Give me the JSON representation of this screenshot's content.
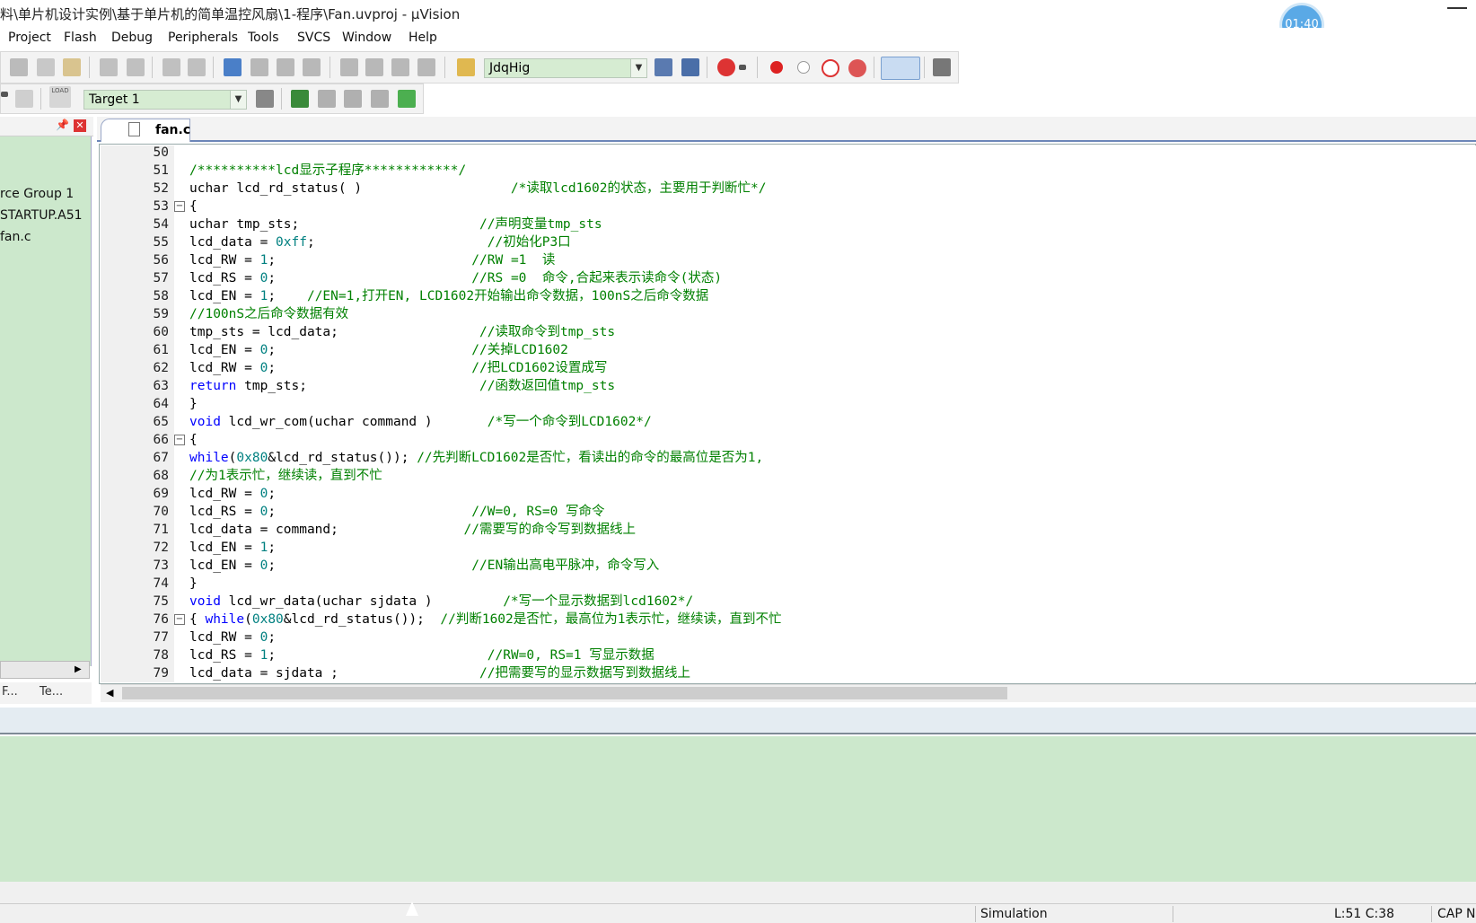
{
  "window": {
    "title": "料\\单片机设计实例\\基于单片机的简单温控风扇\\1-程序\\Fan.uvproj - µVision",
    "timer": "01:40"
  },
  "menu": [
    "Project",
    "Flash",
    "Debug",
    "Peripherals",
    "Tools",
    "SVCS",
    "Window",
    "Help"
  ],
  "toolbar": {
    "find_combo_value": "JdqHig",
    "target_combo_value": "Target 1",
    "load_label": "LOAD"
  },
  "project_panel": {
    "items": [
      "rce Group 1",
      "STARTUP.A51",
      "fan.c"
    ],
    "tabs": [
      "F...",
      "Te..."
    ]
  },
  "editor": {
    "tab_label": "fan.c",
    "lines": [
      {
        "n": "50",
        "fold": "",
        "segs": [
          {
            "t": "",
            "c": "tx"
          }
        ]
      },
      {
        "n": "51",
        "fold": "",
        "segs": [
          {
            "t": "/**********lcd显示子程序************/",
            "c": "cm"
          }
        ]
      },
      {
        "n": "52",
        "fold": "",
        "segs": [
          {
            "t": "uchar lcd_rd_status( )                   ",
            "c": "tx"
          },
          {
            "t": "/*读取lcd1602的状态，主要用于判断忙*/",
            "c": "cm"
          }
        ]
      },
      {
        "n": "53",
        "fold": "−",
        "segs": [
          {
            "t": "{",
            "c": "tx"
          }
        ]
      },
      {
        "n": "54",
        "fold": "",
        "segs": [
          {
            "t": "uchar tmp_sts;                       ",
            "c": "tx"
          },
          {
            "t": "//声明变量tmp_sts",
            "c": "cm"
          }
        ]
      },
      {
        "n": "55",
        "fold": "",
        "segs": [
          {
            "t": "lcd_data = ",
            "c": "tx"
          },
          {
            "t": "0xff",
            "c": "num"
          },
          {
            "t": ";                      ",
            "c": "tx"
          },
          {
            "t": "//初始化P3口",
            "c": "cm"
          }
        ]
      },
      {
        "n": "56",
        "fold": "",
        "segs": [
          {
            "t": "lcd_RW = ",
            "c": "tx"
          },
          {
            "t": "1",
            "c": "num"
          },
          {
            "t": ";                         ",
            "c": "tx"
          },
          {
            "t": "//RW =1  读",
            "c": "cm"
          }
        ]
      },
      {
        "n": "57",
        "fold": "",
        "segs": [
          {
            "t": "lcd_RS = ",
            "c": "tx"
          },
          {
            "t": "0",
            "c": "num"
          },
          {
            "t": ";                         ",
            "c": "tx"
          },
          {
            "t": "//RS =0  命令,合起来表示读命令(状态)",
            "c": "cm"
          }
        ]
      },
      {
        "n": "58",
        "fold": "",
        "segs": [
          {
            "t": "lcd_EN = ",
            "c": "tx"
          },
          {
            "t": "1",
            "c": "num"
          },
          {
            "t": ";    ",
            "c": "tx"
          },
          {
            "t": "//EN=1,打开EN, LCD1602开始输出命令数据，100nS之后命令数据",
            "c": "cm"
          }
        ]
      },
      {
        "n": "59",
        "fold": "",
        "segs": [
          {
            "t": "//100nS之后命令数据有效",
            "c": "cm"
          }
        ]
      },
      {
        "n": "60",
        "fold": "",
        "segs": [
          {
            "t": "tmp_sts = lcd_data;                  ",
            "c": "tx"
          },
          {
            "t": "//读取命令到tmp_sts",
            "c": "cm"
          }
        ]
      },
      {
        "n": "61",
        "fold": "",
        "segs": [
          {
            "t": "lcd_EN = ",
            "c": "tx"
          },
          {
            "t": "0",
            "c": "num"
          },
          {
            "t": ";                         ",
            "c": "tx"
          },
          {
            "t": "//关掉LCD1602",
            "c": "cm"
          }
        ]
      },
      {
        "n": "62",
        "fold": "",
        "segs": [
          {
            "t": "lcd_RW = ",
            "c": "tx"
          },
          {
            "t": "0",
            "c": "num"
          },
          {
            "t": ";                         ",
            "c": "tx"
          },
          {
            "t": "//把LCD1602设置成写",
            "c": "cm"
          }
        ]
      },
      {
        "n": "63",
        "fold": "",
        "segs": [
          {
            "t": "return",
            "c": "kw"
          },
          {
            "t": " tmp_sts;                      ",
            "c": "tx"
          },
          {
            "t": "//函数返回值tmp_sts",
            "c": "cm"
          }
        ]
      },
      {
        "n": "64",
        "fold": "",
        "segs": [
          {
            "t": "}",
            "c": "tx"
          }
        ]
      },
      {
        "n": "65",
        "fold": "",
        "segs": [
          {
            "t": "void",
            "c": "kw"
          },
          {
            "t": " lcd_wr_com(uchar command )       ",
            "c": "tx"
          },
          {
            "t": "/*写一个命令到LCD1602*/",
            "c": "cm"
          }
        ]
      },
      {
        "n": "66",
        "fold": "−",
        "segs": [
          {
            "t": "{",
            "c": "tx"
          }
        ]
      },
      {
        "n": "67",
        "fold": "",
        "segs": [
          {
            "t": "while",
            "c": "kw"
          },
          {
            "t": "(",
            "c": "tx"
          },
          {
            "t": "0x80",
            "c": "num"
          },
          {
            "t": "&lcd_rd_status()); ",
            "c": "tx"
          },
          {
            "t": "//先判断LCD1602是否忙，看读出的命令的最高位是否为1,",
            "c": "cm"
          }
        ]
      },
      {
        "n": "68",
        "fold": "",
        "segs": [
          {
            "t": "//为1表示忙，继续读，直到不忙",
            "c": "cm"
          }
        ]
      },
      {
        "n": "69",
        "fold": "",
        "segs": [
          {
            "t": "lcd_RW = ",
            "c": "tx"
          },
          {
            "t": "0",
            "c": "num"
          },
          {
            "t": ";",
            "c": "tx"
          }
        ]
      },
      {
        "n": "70",
        "fold": "",
        "segs": [
          {
            "t": "lcd_RS = ",
            "c": "tx"
          },
          {
            "t": "0",
            "c": "num"
          },
          {
            "t": ";                         ",
            "c": "tx"
          },
          {
            "t": "//W=0, RS=0 写命令",
            "c": "cm"
          }
        ]
      },
      {
        "n": "71",
        "fold": "",
        "segs": [
          {
            "t": "lcd_data = command;                ",
            "c": "tx"
          },
          {
            "t": "//需要写的命令写到数据线上",
            "c": "cm"
          }
        ]
      },
      {
        "n": "72",
        "fold": "",
        "segs": [
          {
            "t": "lcd_EN = ",
            "c": "tx"
          },
          {
            "t": "1",
            "c": "num"
          },
          {
            "t": ";",
            "c": "tx"
          }
        ]
      },
      {
        "n": "73",
        "fold": "",
        "segs": [
          {
            "t": "lcd_EN = ",
            "c": "tx"
          },
          {
            "t": "0",
            "c": "num"
          },
          {
            "t": ";                         ",
            "c": "tx"
          },
          {
            "t": "//EN输出高电平脉冲，命令写入",
            "c": "cm"
          }
        ]
      },
      {
        "n": "74",
        "fold": "",
        "segs": [
          {
            "t": "}",
            "c": "tx"
          }
        ]
      },
      {
        "n": "75",
        "fold": "",
        "segs": [
          {
            "t": "void",
            "c": "kw"
          },
          {
            "t": " lcd_wr_data(uchar sjdata )         ",
            "c": "tx"
          },
          {
            "t": "/*写一个显示数据到lcd1602*/",
            "c": "cm"
          }
        ]
      },
      {
        "n": "76",
        "fold": "−",
        "segs": [
          {
            "t": "{ ",
            "c": "tx"
          },
          {
            "t": "while",
            "c": "kw"
          },
          {
            "t": "(",
            "c": "tx"
          },
          {
            "t": "0x80",
            "c": "num"
          },
          {
            "t": "&lcd_rd_status());  ",
            "c": "tx"
          },
          {
            "t": "//判断1602是否忙，最高位为1表示忙，继续读，直到不忙",
            "c": "cm"
          }
        ]
      },
      {
        "n": "77",
        "fold": "",
        "segs": [
          {
            "t": "lcd_RW = ",
            "c": "tx"
          },
          {
            "t": "0",
            "c": "num"
          },
          {
            "t": ";",
            "c": "tx"
          }
        ]
      },
      {
        "n": "78",
        "fold": "",
        "segs": [
          {
            "t": "lcd_RS = ",
            "c": "tx"
          },
          {
            "t": "1",
            "c": "num"
          },
          {
            "t": ";                           ",
            "c": "tx"
          },
          {
            "t": "//RW=0, RS=1 写显示数据",
            "c": "cm"
          }
        ]
      },
      {
        "n": "79",
        "fold": "",
        "segs": [
          {
            "t": "lcd_data = sjdata ;                  ",
            "c": "tx"
          },
          {
            "t": "//把需要写的显示数据写到数据线上",
            "c": "cm"
          }
        ]
      }
    ]
  },
  "status": {
    "mode": "Simulation",
    "position": "L:51 C:38",
    "cap": "CAP",
    "num": "N"
  }
}
